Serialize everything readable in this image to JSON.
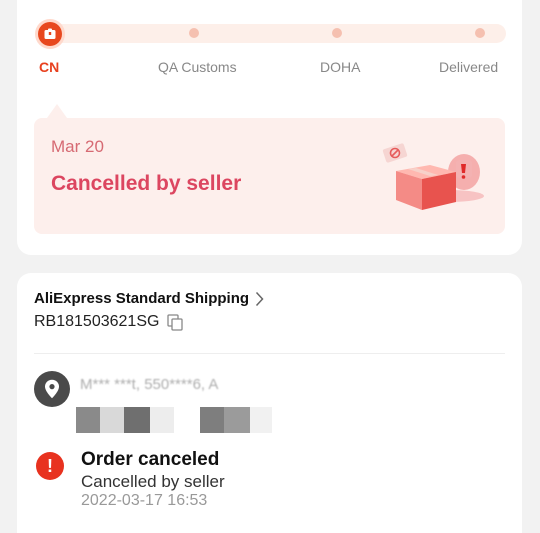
{
  "progress": {
    "steps": [
      "CN",
      "QA Customs",
      "DOHA",
      "Delivered"
    ],
    "active_index": 0
  },
  "status": {
    "date": "Mar 20",
    "title": "Cancelled by seller"
  },
  "shipping": {
    "method": "AliExpress Standard Shipping",
    "tracking_number": "RB181503621SG"
  },
  "address": {
    "text": "M*** ***t, 550****6, A"
  },
  "order_status": {
    "title": "Order canceled",
    "subtitle": "Cancelled by seller",
    "timestamp": "2022-03-17 16:53"
  },
  "colors": {
    "accent": "#e8411f",
    "status_text": "#dc4660",
    "status_bg": "#fdefec",
    "alert": "#e8321f"
  }
}
